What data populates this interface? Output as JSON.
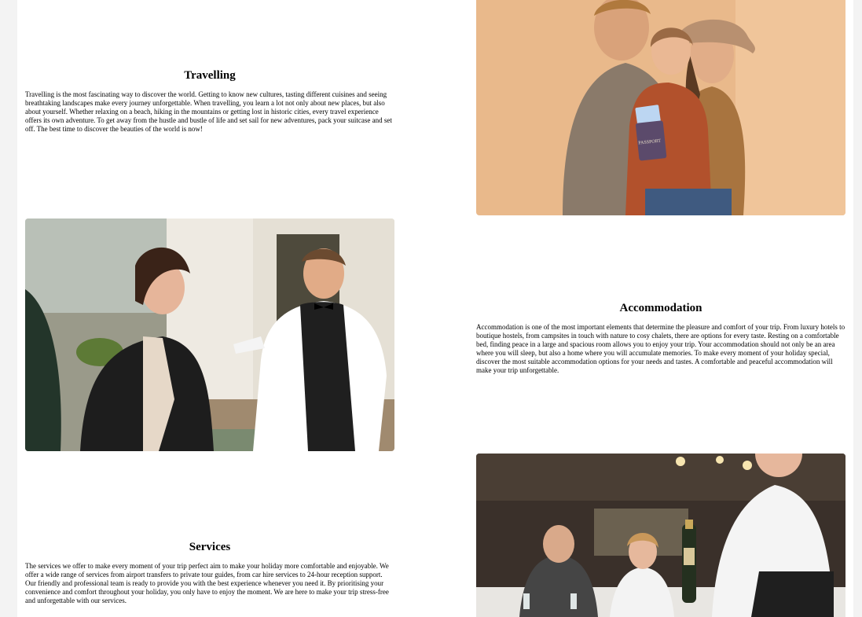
{
  "sections": [
    {
      "title": "Travelling",
      "body": "Travelling is the most fascinating way to discover the world. Getting to know new cultures, tasting different cuisines and seeing breathtaking landscapes make every journey unforgettable. When travelling, you learn a lot not only about new places, but also about yourself. Whether relaxing on a beach, hiking in the mountains or getting lost in historic cities, every travel experience offers its own adventure. To get away from the hustle and bustle of life and set sail for new adventures, pack your suitcase and set off. The best time to discover the beauties of the world is now!",
      "passport_label": "PASSPORT"
    },
    {
      "title": "Accommodation",
      "body": "Accommodation is one of the most important elements that determine the pleasure and comfort of your trip. From luxury hotels to boutique hostels, from campsites in touch with nature to cosy chalets, there are options for every taste. Resting on a comfortable bed, finding peace in a large and spacious room allows you to enjoy your trip. Your accommodation should not only be an area where you will sleep, but also a home where you will accumulate memories. To make every moment of your holiday special, discover the most suitable accommodation options for your needs and tastes. A comfortable and peaceful accommodation will make your trip unforgettable."
    },
    {
      "title": "Services",
      "body": "The services we offer to make every moment of your trip perfect aim to make your holiday more comfortable and enjoyable. We offer a wide range of services from airport transfers to private tour guides, from car hire services to 24-hour reception support. Our friendly and professional team is ready to provide you with the best experience whenever you need it. By prioritising your convenience and comfort throughout your holiday, you only have to enjoy the moment. We are here to make your trip stress-free and unforgettable with our services."
    }
  ],
  "colors": {
    "page_bg": "#f3f3f3",
    "card_bg": "#ffffff",
    "travel_photo_bg": "#e8b98a",
    "restaurant_photo_bg": "#3a302a"
  }
}
